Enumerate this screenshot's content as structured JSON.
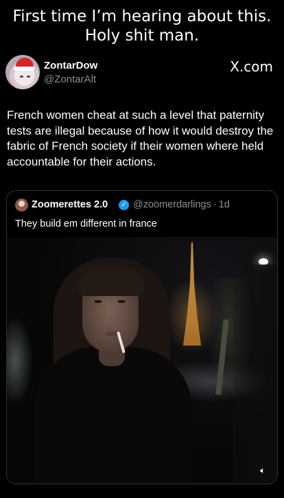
{
  "caption": {
    "line1": "First time I’m hearing about this.",
    "line2": "Holy shit man."
  },
  "post": {
    "author_name": "ZontarDow",
    "author_handle": "@ZontarAlt",
    "platform_logo": "X.com",
    "body": "French women cheat at such a level that paternity tests are illegal because of how it would destroy the fabric of French society if their women where held accountable for their actions."
  },
  "quote": {
    "author_name": "Zoomerettes 2.0",
    "verified": true,
    "author_handle": "@zoomerdarlings",
    "separator": "·",
    "time_ago": "1d",
    "text": "They build em different in france",
    "media": {
      "type": "video",
      "mute_icon": "volume-muted-icon"
    }
  },
  "icons": {
    "avatar": "santa-hat-anime-avatar",
    "verified": "verified-check-icon",
    "mute": "volume-muted-icon"
  },
  "colors": {
    "background": "#000000",
    "text": "#ffffff",
    "muted_text": "#8b8f94",
    "border": "#2f3336",
    "verified_blue": "#1d9bf0"
  }
}
